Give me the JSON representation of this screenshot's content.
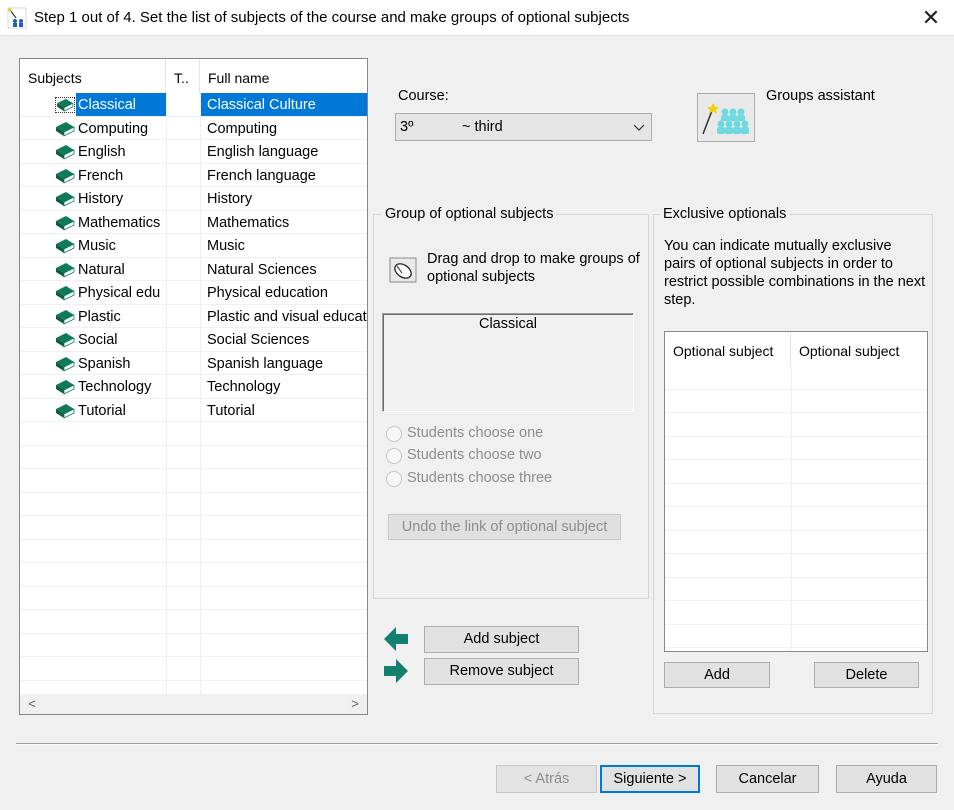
{
  "window": {
    "title": "Step 1 out of 4. Set the list of subjects of the course and make groups of optional subjects",
    "close_glyph": "✕"
  },
  "subjects_table": {
    "columns": [
      "Subjects",
      "T..",
      "Full name"
    ],
    "selected_index": 0,
    "rows": [
      {
        "subject": "Classical",
        "type": "",
        "full_name": "Classical Culture"
      },
      {
        "subject": "Computing",
        "type": "",
        "full_name": "Computing"
      },
      {
        "subject": "English",
        "type": "",
        "full_name": "English language"
      },
      {
        "subject": "French",
        "type": "",
        "full_name": "French language"
      },
      {
        "subject": "History",
        "type": "",
        "full_name": "History"
      },
      {
        "subject": "Mathematics",
        "type": "",
        "full_name": "Mathematics"
      },
      {
        "subject": "Music",
        "type": "",
        "full_name": "Music"
      },
      {
        "subject": "Natural",
        "type": "",
        "full_name": "Natural Sciences"
      },
      {
        "subject": "Physical edu",
        "type": "",
        "full_name": "Physical education"
      },
      {
        "subject": "Plastic",
        "type": "",
        "full_name": "Plastic and visual educat"
      },
      {
        "subject": "Social",
        "type": "",
        "full_name": "Social Sciences"
      },
      {
        "subject": "Spanish",
        "type": "",
        "full_name": "Spanish language"
      },
      {
        "subject": "Technology",
        "type": "",
        "full_name": "Technology"
      },
      {
        "subject": "Tutorial",
        "type": "",
        "full_name": "Tutorial"
      }
    ],
    "row_icon": "book-icon",
    "scroll_left": "<",
    "scroll_right": ">"
  },
  "course": {
    "label": "Course:",
    "code": "3º",
    "name": "~ third"
  },
  "groups_assistant": {
    "label": "Groups assistant",
    "icon": "groups-assistant-icon"
  },
  "optional_group": {
    "legend": "Group of optional subjects",
    "drag_text": "Drag and drop to make groups of optional subjects",
    "drag_icon": "mouse-icon",
    "group_items": [
      "Classical"
    ],
    "radio_options": [
      "Students choose one",
      "Students choose two",
      "Students choose three"
    ],
    "undo_label": "Undo the link of optional subject"
  },
  "subject_actions": {
    "add_label": "Add subject",
    "remove_label": "Remove subject"
  },
  "exclusive": {
    "legend": "Exclusive optionals",
    "description": "You can indicate mutually exclusive pairs of optional subjects in order to restrict possible combinations in the next step.",
    "columns": [
      "Optional subject",
      "Optional subject"
    ],
    "add_label": "Add",
    "delete_label": "Delete"
  },
  "footer": {
    "back_label": "< Atrás",
    "next_label": "Siguiente >",
    "cancel_label": "Cancelar",
    "help_label": "Ayuda"
  },
  "colors": {
    "selection": "#0078d7",
    "book_green": "#0f7a5a",
    "arrow_teal": "#12806e",
    "default_button_border": "#0078d7"
  }
}
